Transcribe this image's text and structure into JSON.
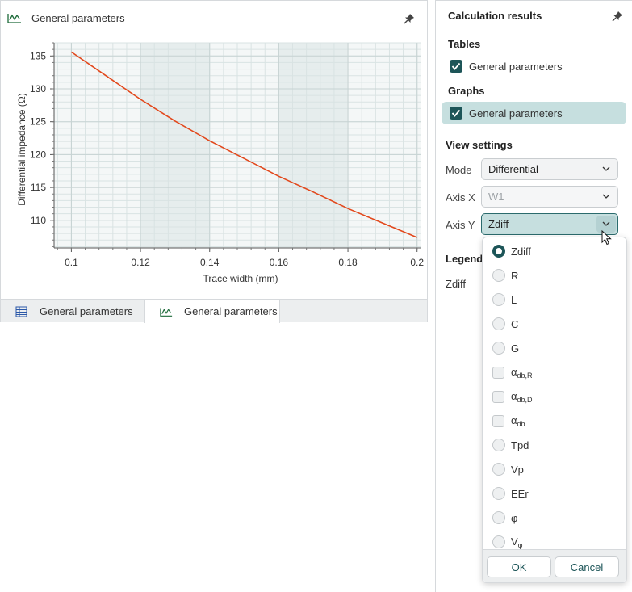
{
  "graph_panel": {
    "title": "General parameters",
    "icon": "line-graph-icon",
    "tabs": [
      {
        "label": "General parameters",
        "icon": "table-icon"
      },
      {
        "label": "General parameters",
        "icon": "line-graph-icon",
        "active": true
      }
    ]
  },
  "chart_data": {
    "type": "line",
    "title": "",
    "xlabel": "Trace width (mm)",
    "ylabel": "Differential impedance (Ω)",
    "xlim": [
      0.095,
      0.201
    ],
    "ylim": [
      105.8,
      137
    ],
    "x_ticks": [
      "0.1",
      "0.12",
      "0.14",
      "0.16",
      "0.18",
      "0.2"
    ],
    "y_ticks": [
      "110",
      "115",
      "120",
      "125",
      "130",
      "135"
    ],
    "series": [
      {
        "color": "#e2481c",
        "x": [
          0.1,
          0.11,
          0.12,
          0.13,
          0.14,
          0.15,
          0.16,
          0.17,
          0.18,
          0.19,
          0.2
        ],
        "y": [
          135.6,
          132.0,
          128.4,
          125.1,
          122.1,
          119.4,
          116.7,
          114.3,
          111.8,
          109.6,
          107.4
        ]
      }
    ]
  },
  "results": {
    "title": "Calculation results",
    "tables_label": "Tables",
    "tables_item": "General parameters",
    "graphs_label": "Graphs",
    "graphs_item": "General parameters",
    "view_settings_label": "View settings",
    "mode_label": "Mode",
    "mode_value": "Differential",
    "axis_x_label": "Axis X",
    "axis_x_value": "W1",
    "axis_y_label": "Axis Y",
    "axis_y_value": "Zdiff",
    "legend_label": "Legend",
    "legend_item": "Zdiff"
  },
  "dropdown": {
    "options": [
      {
        "label": "Zdiff",
        "kind": "radio",
        "selected": true
      },
      {
        "label": "R",
        "kind": "radio"
      },
      {
        "label": "L",
        "kind": "radio"
      },
      {
        "label": "C",
        "kind": "radio"
      },
      {
        "label": "G",
        "kind": "radio"
      },
      {
        "label": "α",
        "sub": "db,R",
        "kind": "check"
      },
      {
        "label": "α",
        "sub": "db,D",
        "kind": "check"
      },
      {
        "label": "α",
        "sub": "db",
        "kind": "check"
      },
      {
        "label": "Tpd",
        "kind": "radio"
      },
      {
        "label": "Vp",
        "kind": "radio"
      },
      {
        "label": "EEr",
        "kind": "radio"
      },
      {
        "label": "φ",
        "kind": "radio"
      },
      {
        "label": "V",
        "sub": "φ",
        "kind": "radio"
      }
    ],
    "ok_label": "OK",
    "cancel_label": "Cancel"
  },
  "colors": {
    "accent": "#1d5558",
    "selected_bg": "#c6dfdf",
    "line": "#e2481c"
  }
}
